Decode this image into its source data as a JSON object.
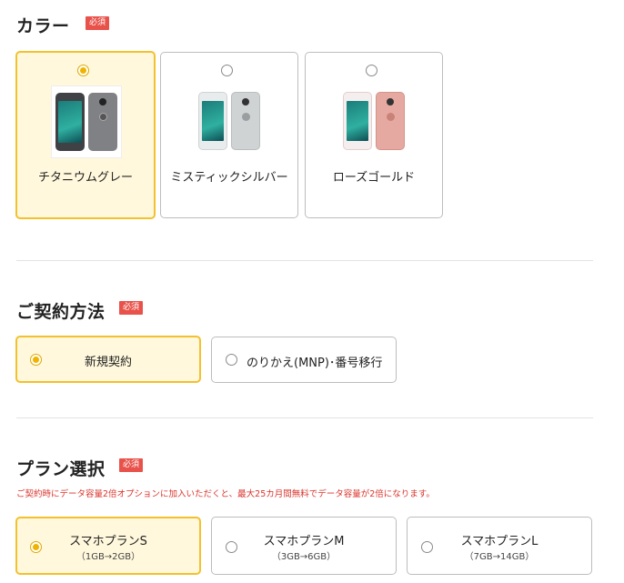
{
  "color_section": {
    "title": "カラー",
    "badge": "必須",
    "options": [
      {
        "label": "チタニウムグレー",
        "selected": true,
        "body_color": "#5b5d61",
        "back_color": "#8d8f93"
      },
      {
        "label": "ミスティックシルバー",
        "selected": false,
        "body_color": "#e9ecec",
        "back_color": "#cfd3d4"
      },
      {
        "label": "ローズゴールド",
        "selected": false,
        "body_color": "#f4efee",
        "back_color": "#e6a9a2"
      }
    ]
  },
  "contract_section": {
    "title": "ご契約方法",
    "badge": "必須",
    "options": [
      {
        "label": "新規契約",
        "selected": true
      },
      {
        "label": "のりかえ(MNP)･番号移行",
        "selected": false
      }
    ]
  },
  "plan_section": {
    "title": "プラン選択",
    "badge": "必須",
    "note": "ご契約時にデータ容量2倍オプションに加入いただくと、最大25カ月間無料でデータ容量が2倍になります。",
    "options": [
      {
        "name": "スマホプランS",
        "detail": "（1GB→2GB）",
        "selected": true
      },
      {
        "name": "スマホプランM",
        "detail": "（3GB→6GB）",
        "selected": false
      },
      {
        "name": "スマホプランL",
        "detail": "（7GB→14GB）",
        "selected": false
      }
    ]
  },
  "colors": {
    "accent_border": "#f2c12e",
    "accent_fill": "#fff8dc",
    "badge_red": "#e8524a",
    "note_red": "#d9332b"
  }
}
